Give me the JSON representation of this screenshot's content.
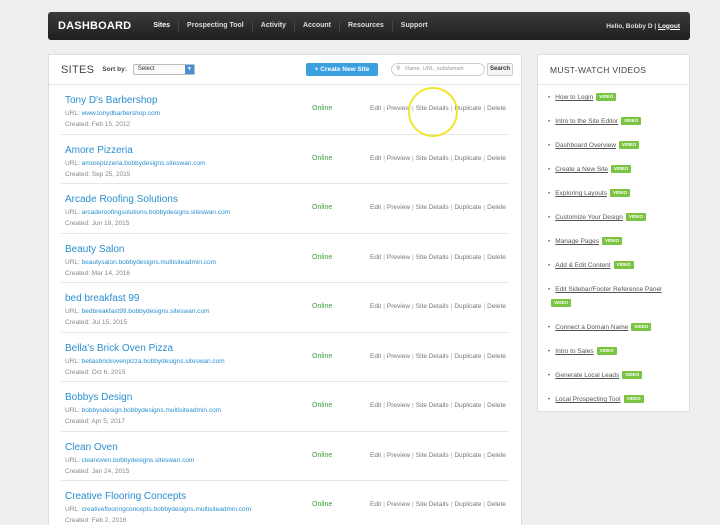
{
  "topbar": {
    "brand": "DASHBOARD",
    "nav": [
      "Sites",
      "Prospecting Tool",
      "Activity",
      "Account",
      "Resources",
      "Support"
    ],
    "active": "Sites",
    "hello": "Hello, Bobby D |",
    "logout": "Logout"
  },
  "header": {
    "title": "SITES",
    "sort_label": "Sort by:",
    "sort_value": "Select",
    "create_label": "+ Create New Site",
    "search_placeholder": "Name, URL, subdomain",
    "search_button": "Search"
  },
  "sites": [
    {
      "name": "Tony D's Barbershop",
      "url": "www.tonydbarbershop.com",
      "created": "Created: Feb 15, 2012",
      "status": "Online"
    },
    {
      "name": "Amore Pizzeria",
      "url": "amorepizzeria.bobbydesigns.siteswan.com",
      "created": "Created: Sep 25, 2015",
      "status": "Online"
    },
    {
      "name": "Arcade Roofing Solutions",
      "url": "arcaderoofingsolutions.bobbydesigns.siteswan.com",
      "created": "Created: Jun 18, 2015",
      "status": "Online"
    },
    {
      "name": "Beauty Salon",
      "url": "beautysalon.bobbydesigns.multisiteadmin.com",
      "created": "Created: Mar 14, 2016",
      "status": "Online"
    },
    {
      "name": "bed breakfast 99",
      "url": "bedbreakfast99.bobbydesigns.siteswan.com",
      "created": "Created: Jul 15, 2015",
      "status": "Online"
    },
    {
      "name": "Bella's Brick Oven Pizza",
      "url": "bellasbrickovenpizza.bobbydesigns.siteswan.com",
      "created": "Created: Oct 6, 2015",
      "status": "Online"
    },
    {
      "name": "Bobbys Design",
      "url": "bobbysdesign.bobbydesigns.multisiteadmin.com",
      "created": "Created: Apr 5, 2017",
      "status": "Online"
    },
    {
      "name": "Clean Oven",
      "url": "cleanoven.bobbydesigns.siteswan.com",
      "created": "Created: Jan 24, 2015",
      "status": "Online"
    },
    {
      "name": "Creative Flooring Concepts",
      "url": "creativeflooringconcepts.bobbydesigns.multisiteadmin.com",
      "created": "Created: Feb 2, 2016",
      "status": "Online"
    }
  ],
  "row_labels": {
    "url_prefix": "URL:",
    "edit": "Edit",
    "preview": "Preview",
    "site_details": "Site Details",
    "duplicate": "Duplicate",
    "delete": "Delete"
  },
  "videos": {
    "title": "MUST-WATCH VIDEOS",
    "badge": "VIDEO",
    "items": [
      "How to Login",
      "Intro to the Site Editor",
      "Dashboard Overview",
      "Create a New Site",
      "Exploring Layouts",
      "Customize Your Design",
      "Manage Pages",
      "Add & Edit Content",
      "Edit Sidebar/Footer Reference Panel",
      "Connect a Domain Name",
      "Intro to Sales",
      "Generate Local Leads",
      "Local Prospecting Tool"
    ]
  },
  "colors": {
    "accent": "#2a8fd0",
    "online": "#3aa03a",
    "badge": "#7bc442",
    "highlight": "#f2e62c"
  }
}
